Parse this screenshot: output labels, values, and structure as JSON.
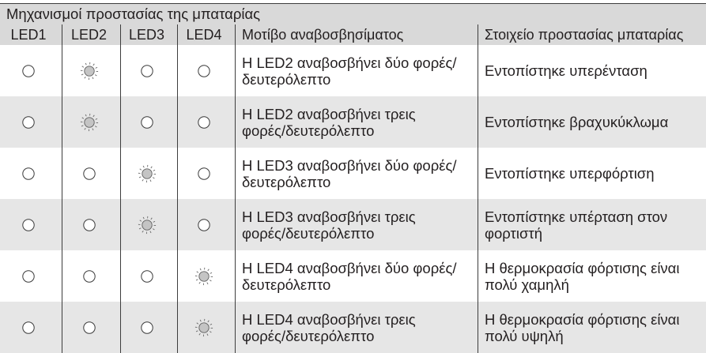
{
  "title": "Μηχανισμοί προστασίας της μπαταρίας",
  "columns": [
    "LED1",
    "LED2",
    "LED3",
    "LED4",
    "Μοτίβο αναβοσβησίματος",
    "Στοιχείο προστασίας μπαταρίας"
  ],
  "rows": [
    {
      "leds": [
        "led-off-icon",
        "led-blinking-icon",
        "led-off-icon",
        "led-off-icon"
      ],
      "pattern": [
        "Η LED2 αναβοσβήνει δύο φορές/",
        "δευτερόλεπτο"
      ],
      "protection": [
        "Εντοπίστηκε υπερένταση"
      ]
    },
    {
      "leds": [
        "led-off-icon",
        "led-blinking-icon",
        "led-off-icon",
        "led-off-icon"
      ],
      "pattern": [
        "Η LED2 αναβοσβήνει τρεις",
        "φορές/δευτερόλεπτο"
      ],
      "protection": [
        "Εντοπίστηκε βραχυκύκλωμα"
      ]
    },
    {
      "leds": [
        "led-off-icon",
        "led-off-icon",
        "led-blinking-icon",
        "led-off-icon"
      ],
      "pattern": [
        "Η LED3 αναβοσβήνει δύο φορές/",
        "δευτερόλεπτο"
      ],
      "protection": [
        "Εντοπίστηκε υπερφόρτιση"
      ]
    },
    {
      "leds": [
        "led-off-icon",
        "led-off-icon",
        "led-blinking-icon",
        "led-off-icon"
      ],
      "pattern": [
        "Η LED3 αναβοσβήνει τρεις",
        "φορές/δευτερόλεπτο"
      ],
      "protection": [
        "Εντοπίστηκε υπέρταση στον",
        "φορτιστή"
      ]
    },
    {
      "leds": [
        "led-off-icon",
        "led-off-icon",
        "led-off-icon",
        "led-blinking-icon"
      ],
      "pattern": [
        "Η LED4 αναβοσβήνει δύο φορές/",
        "δευτερόλεπτο"
      ],
      "protection": [
        "Η θερμοκρασία φόρτισης είναι",
        "πολύ χαμηλή"
      ]
    },
    {
      "leds": [
        "led-off-icon",
        "led-off-icon",
        "led-off-icon",
        "led-blinking-icon"
      ],
      "pattern": [
        "Η LED4 αναβοσβήνει τρεις",
        "φορές/δευτερόλεπτο"
      ],
      "protection": [
        "Η θερμοκρασία φόρτισης είναι",
        "πολύ υψηλή"
      ]
    }
  ]
}
